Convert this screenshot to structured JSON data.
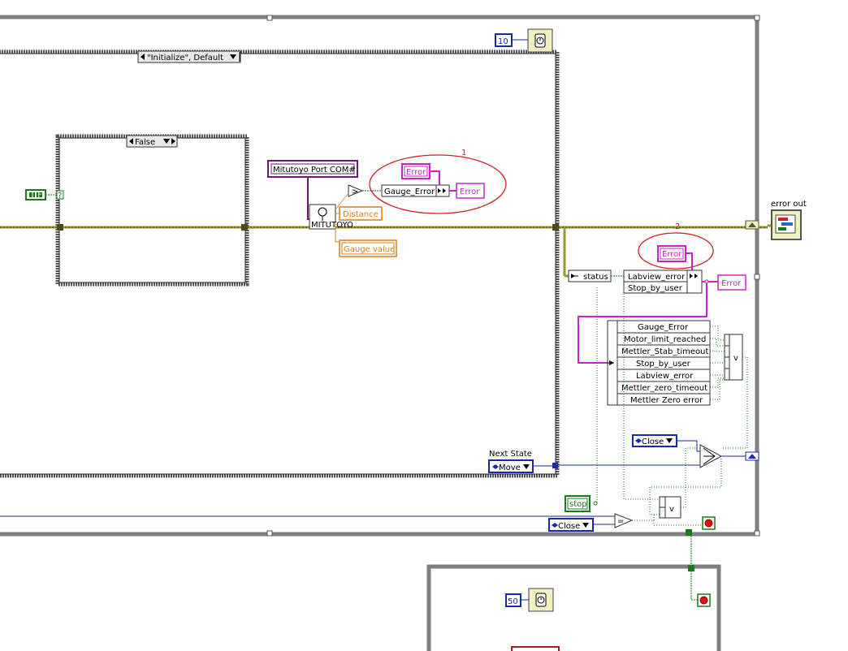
{
  "case_selector": "\"Initialize\", Default",
  "inner_case_selector": "False",
  "wait_loop_ms": "10",
  "wait_bottom_ms": "50",
  "bool_constant": "F",
  "bool_tf": "T F",
  "mitutoyo_port_label": "Mitutoyo Port COM#",
  "mitutoyo_vi_label": "MITUTOYO",
  "distance_label": "Distance",
  "gauge_value_label": "Gauge value",
  "annotation_1": {
    "number": "1",
    "error_in": "Error",
    "enum": "Gauge_Error",
    "error_out": "Error"
  },
  "annotation_2": {
    "number": "2",
    "error_in": "Error"
  },
  "status_label": "status",
  "bundle_items": [
    "Labview_error",
    "Stop_by_user"
  ],
  "error_out_cluster": "Error",
  "error_out_terminal": "error out",
  "error_list": [
    "Gauge_Error",
    "Motor_limit_reached",
    "Mettler_Stab_timeout",
    "Stop_by_user",
    "Labview_error",
    "Mettler_zero_timeout",
    "Mettler Zero error"
  ],
  "or_symbol": "v",
  "next_state_label": "Next State",
  "next_state_value": "Move",
  "close_select_value": "Close",
  "stop_label": "stop",
  "close_compare_value": "Close"
}
